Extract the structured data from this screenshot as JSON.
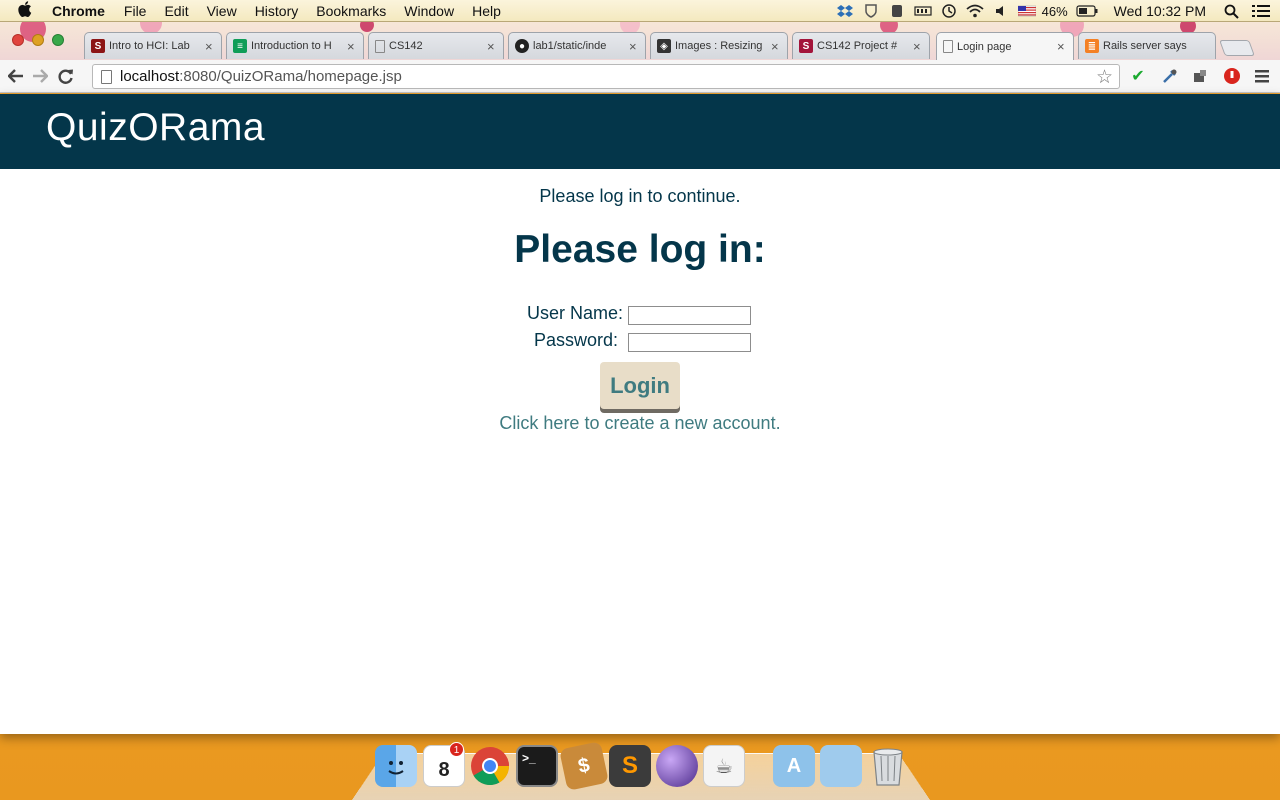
{
  "menubar": {
    "app_name": "Chrome",
    "items": [
      "File",
      "Edit",
      "View",
      "History",
      "Bookmarks",
      "Window",
      "Help"
    ],
    "battery_percent": "46%",
    "clock": "Wed 10:32 PM",
    "status_icons": [
      "dropbox-icon",
      "shield-icon",
      "evernote-icon",
      "battery-meter-icon",
      "time-machine-icon",
      "wifi-icon",
      "volume-icon",
      "flag-icon",
      "battery-icon",
      "search-icon",
      "list-icon"
    ]
  },
  "tabs": [
    {
      "title": "Intro to HCI: Lab",
      "favicon": "stanford-icon",
      "color": "#8c1515",
      "active": false
    },
    {
      "title": "Introduction to H",
      "favicon": "sheets-icon",
      "color": "#0f9d58",
      "active": false
    },
    {
      "title": "CS142",
      "favicon": "page-icon",
      "color": "#dddddd",
      "active": false
    },
    {
      "title": "lab1/static/inde",
      "favicon": "github-icon",
      "color": "#222222",
      "active": false
    },
    {
      "title": "Images : Resizing",
      "favicon": "tool-icon",
      "color": "#333333",
      "active": false
    },
    {
      "title": "CS142 Project #",
      "favicon": "s-icon",
      "color": "#a3143a",
      "active": false
    },
    {
      "title": "Login page",
      "favicon": "page-icon",
      "color": "#dddddd",
      "active": true
    },
    {
      "title": "Rails server says",
      "favicon": "stack-icon",
      "color": "#f48024",
      "active": false
    }
  ],
  "address_bar": {
    "host": "localhost",
    "path": ":8080/QuizORama/homepage.jsp"
  },
  "site": {
    "logo": "QuizORama",
    "notice": "Please log in to continue.",
    "heading": "Please log in:",
    "username_label": "User Name:",
    "password_label": "Password:",
    "username_value": "",
    "password_value": "",
    "login_button": "Login",
    "create_account_link": "Click here to create a new account."
  },
  "colors": {
    "header_bg": "#04364a",
    "text_dark": "#04364a",
    "accent_teal": "#3f7b80",
    "button_bg": "#e8ddc8"
  },
  "dock": {
    "apps": [
      "finder-icon",
      "calendar-icon",
      "chrome-icon",
      "terminal-icon",
      "stamps-icon",
      "sublime-text-icon",
      "eclipse-icon",
      "preview-icon",
      "applications-folder-icon",
      "documents-folder-icon",
      "trash-icon"
    ],
    "calendar_day": "8",
    "calendar_badge": "1"
  }
}
